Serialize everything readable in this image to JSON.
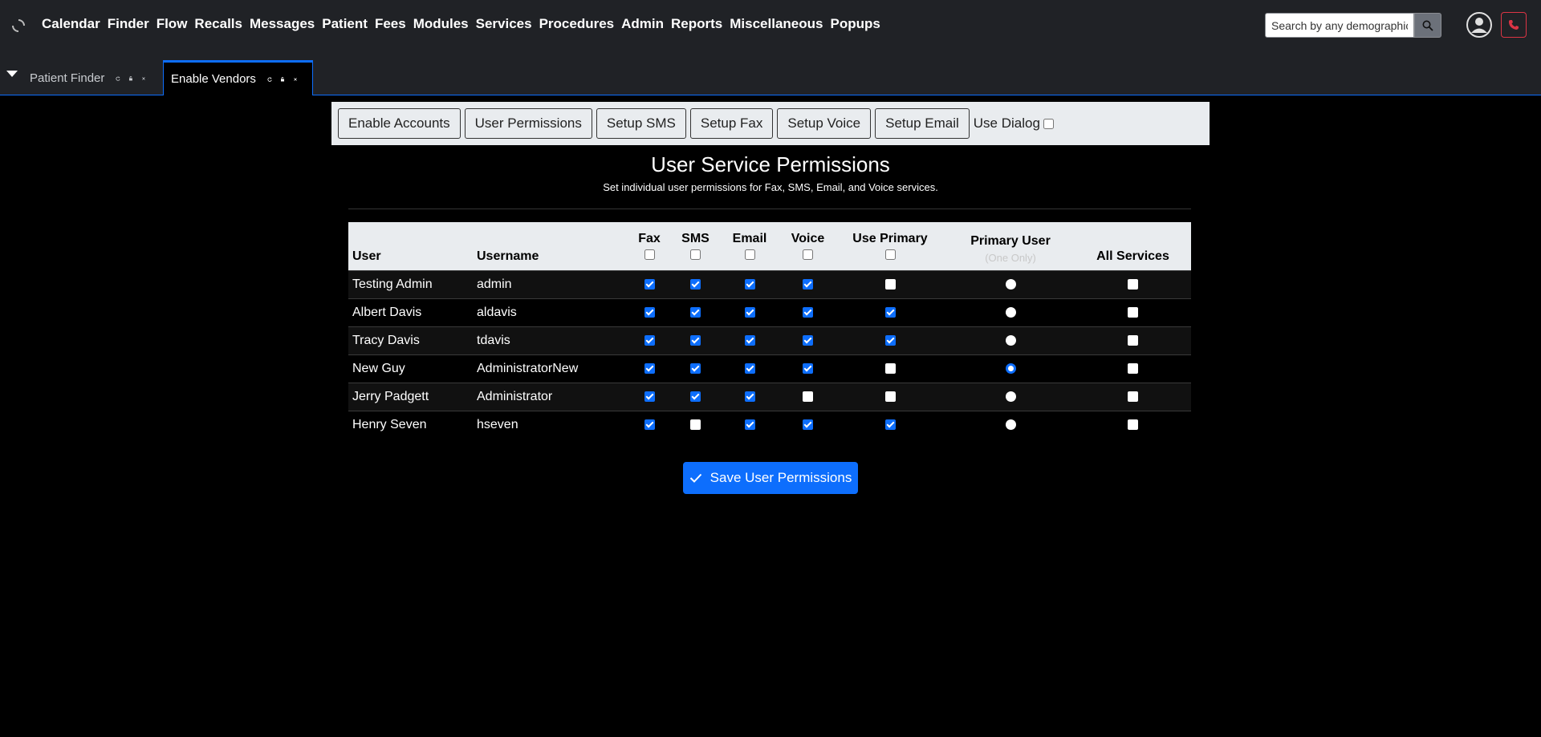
{
  "nav": {
    "items": [
      "Calendar",
      "Finder",
      "Flow",
      "Recalls",
      "Messages",
      "Patient",
      "Fees",
      "Modules",
      "Services",
      "Procedures",
      "Admin",
      "Reports",
      "Miscellaneous",
      "Popups"
    ],
    "search_placeholder": "Search by any demographic"
  },
  "tabs": [
    {
      "label": "Patient Finder",
      "active": false
    },
    {
      "label": "Enable Vendors",
      "active": true
    }
  ],
  "toolbar": {
    "buttons": [
      "Enable Accounts",
      "User Permissions",
      "Setup SMS",
      "Setup Fax",
      "Setup Voice",
      "Setup Email"
    ],
    "use_dialog_label": "Use Dialog"
  },
  "page": {
    "title": "User Service Permissions",
    "subtitle": "Set individual user permissions for Fax, SMS, Email, and Voice services."
  },
  "table": {
    "headers": {
      "user": "User",
      "username": "Username",
      "fax": "Fax",
      "sms": "SMS",
      "email": "Email",
      "voice": "Voice",
      "use_primary": "Use Primary",
      "primary_user": "Primary User",
      "primary_user_note": "(One Only)",
      "all_services": "All Services"
    },
    "rows": [
      {
        "user": "Testing Admin",
        "username": "admin",
        "fax": true,
        "sms": true,
        "email": true,
        "voice": true,
        "use_primary": false,
        "primary_user": false,
        "all_services": false
      },
      {
        "user": "Albert Davis",
        "username": "aldavis",
        "fax": true,
        "sms": true,
        "email": true,
        "voice": true,
        "use_primary": true,
        "primary_user": false,
        "all_services": false
      },
      {
        "user": "Tracy Davis",
        "username": "tdavis",
        "fax": true,
        "sms": true,
        "email": true,
        "voice": true,
        "use_primary": true,
        "primary_user": false,
        "all_services": false
      },
      {
        "user": "New Guy",
        "username": "AdministratorNew",
        "fax": true,
        "sms": true,
        "email": true,
        "voice": true,
        "use_primary": false,
        "primary_user": true,
        "all_services": false
      },
      {
        "user": "Jerry Padgett",
        "username": "Administrator",
        "fax": true,
        "sms": true,
        "email": true,
        "voice": false,
        "use_primary": false,
        "primary_user": false,
        "all_services": false
      },
      {
        "user": "Henry Seven",
        "username": "hseven",
        "fax": true,
        "sms": false,
        "email": true,
        "voice": true,
        "use_primary": true,
        "primary_user": false,
        "all_services": false
      }
    ]
  },
  "save_button": {
    "label": "Save User Permissions"
  },
  "colors": {
    "accent": "#0d6efd",
    "topbar": "#202226",
    "danger": "#dc3545"
  }
}
